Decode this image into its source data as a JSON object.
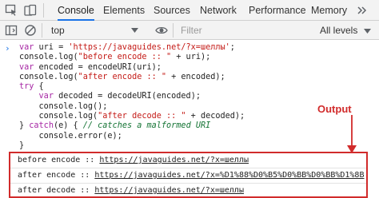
{
  "tabs": {
    "console": "Console",
    "elements": "Elements",
    "sources": "Sources",
    "network": "Network",
    "performance": "Performance",
    "memory": "Memory"
  },
  "toolbar": {
    "context": "top",
    "filter_placeholder": "Filter",
    "levels": "All levels"
  },
  "code": {
    "l1_kw": "var",
    "l1_a": " uri = ",
    "l1_str": "'https://javaguides.net/?x=шеллы'",
    "l1_b": ";",
    "l2_a": "console.log(",
    "l2_str": "\"before encode :: \"",
    "l2_b": " + uri);",
    "l3_kw": "var",
    "l3_a": " encoded = encodeURI(uri);",
    "l4_a": "console.log(",
    "l4_str": "\"after encode :: \"",
    "l4_b": " + encoded);",
    "l5_kw": "try",
    "l5_a": " {",
    "l6_pre": "    ",
    "l6_kw": "var",
    "l6_a": " decoded = decodeURI(encoded);",
    "l7_a": "    console.log();",
    "l8_a": "    console.log(",
    "l8_str": "\"after decode :: \"",
    "l8_b": " + decoded);",
    "l9_a": "} ",
    "l9_kw": "catch",
    "l9_b": "(e) { ",
    "l9_cmt": "// catches a malformed URI",
    "l10_a": "    console.error(e);",
    "l11_a": "}"
  },
  "annotation": "Output",
  "output": {
    "row1_label": "before encode :: ",
    "row1_link": "https://javaguides.net/?x=шеллы",
    "row2_label": "after encode :: ",
    "row2_link": "https://javaguides.net/?x=%D1%88%D0%B5%D0%BB%D0%BB%D1%8B",
    "row3_label": "after decode :: ",
    "row3_link": "https://javaguides.net/?x=шеллы"
  },
  "colors": {
    "accent": "#1a73e8",
    "annotation_red": "#d12b2b",
    "keyword": "#a626a4",
    "string": "#c41a16",
    "comment": "#137333"
  }
}
